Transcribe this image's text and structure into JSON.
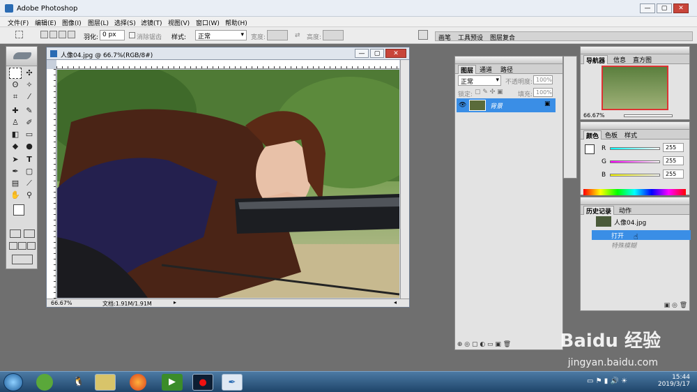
{
  "app": {
    "title": "Adobe Photoshop"
  },
  "window_buttons": [
    "—",
    "▢",
    "✕"
  ],
  "menu": [
    "文件(F)",
    "编辑(E)",
    "图像(I)",
    "图层(L)",
    "选择(S)",
    "滤镜(T)",
    "视图(V)",
    "窗口(W)",
    "帮助(H)"
  ],
  "options": {
    "feather_label": "羽化:",
    "feather_value": "0 px",
    "antialias_label": "消除锯齿",
    "style_label": "样式:",
    "style_value": "正常",
    "width_label": "宽度:",
    "height_label": "高度:"
  },
  "well_tabs": [
    "画笔",
    "工具预设",
    "图层复合"
  ],
  "document": {
    "title": "人像04.jpg @ 66.7%(RGB/8#)",
    "zoom": "66.67%",
    "doc_info": "文档:1.91M/1.91M"
  },
  "layers_panel": {
    "tabs": [
      "图层",
      "通道",
      "路径"
    ],
    "blend_mode": "正常",
    "opacity_label": "不透明度:",
    "opacity_value": "100%",
    "lock_label": "锁定:",
    "fill_label": "填充:",
    "fill_value": "100%",
    "layer_name": "背景"
  },
  "navigator_panel": {
    "tabs": [
      "导航器",
      "信息",
      "直方图"
    ],
    "zoom": "66.67%"
  },
  "color_panel": {
    "tabs": [
      "颜色",
      "色板",
      "样式"
    ],
    "r_label": "R",
    "r_value": "255",
    "g_label": "G",
    "g_value": "255",
    "b_label": "B",
    "b_value": "255"
  },
  "history_panel": {
    "tabs": [
      "历史记录",
      "动作"
    ],
    "snapshot": "人像04.jpg",
    "items": [
      "打开",
      "特殊模糊"
    ]
  },
  "taskbar": {
    "time": "15:44",
    "date": "2019/3/17"
  },
  "watermark": {
    "brand": "Baidu 经验",
    "url": "jingyan.baidu.com"
  }
}
